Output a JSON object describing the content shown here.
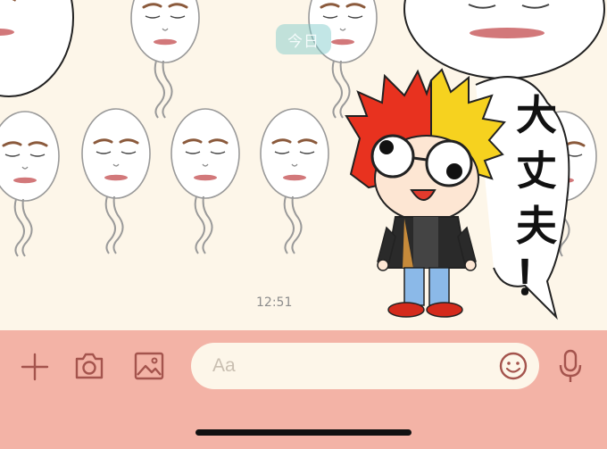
{
  "chat": {
    "date_label": "今日",
    "timestamp": "12:51",
    "sticker_text": "大丈夫！"
  },
  "input": {
    "placeholder": "Aa"
  },
  "icons": {
    "add": "plus-icon",
    "camera": "camera-icon",
    "image": "image-icon",
    "emoji": "smiley-icon",
    "voice": "microphone-icon"
  },
  "colors": {
    "chat_background": "#fdf6e9",
    "input_bar": "#f3b3a6",
    "icon_color": "#a4544d"
  }
}
